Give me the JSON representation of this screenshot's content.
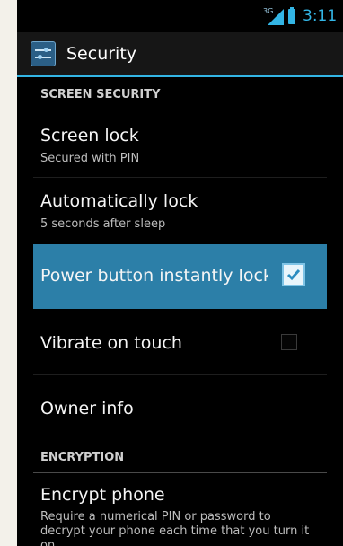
{
  "status_bar": {
    "network": "3G",
    "time": "3:11"
  },
  "action_bar": {
    "title": "Security"
  },
  "sections": {
    "screen_security": "SCREEN SECURITY",
    "encryption": "ENCRYPTION"
  },
  "items": {
    "screen_lock": {
      "title": "Screen lock",
      "subtitle": "Secured with PIN"
    },
    "auto_lock": {
      "title": "Automatically lock",
      "subtitle": "5 seconds after sleep"
    },
    "power_button": {
      "title": "Power button instantly locks",
      "checked": true
    },
    "vibrate": {
      "title": "Vibrate on touch",
      "checked": false
    },
    "owner_info": {
      "title": "Owner info"
    },
    "encrypt_phone": {
      "title": "Encrypt phone",
      "description": "Require a numerical PIN or password to decrypt your phone each time that you turn it on"
    }
  },
  "colors": {
    "accent": "#33b5e5",
    "highlight": "#2c7fa8"
  }
}
